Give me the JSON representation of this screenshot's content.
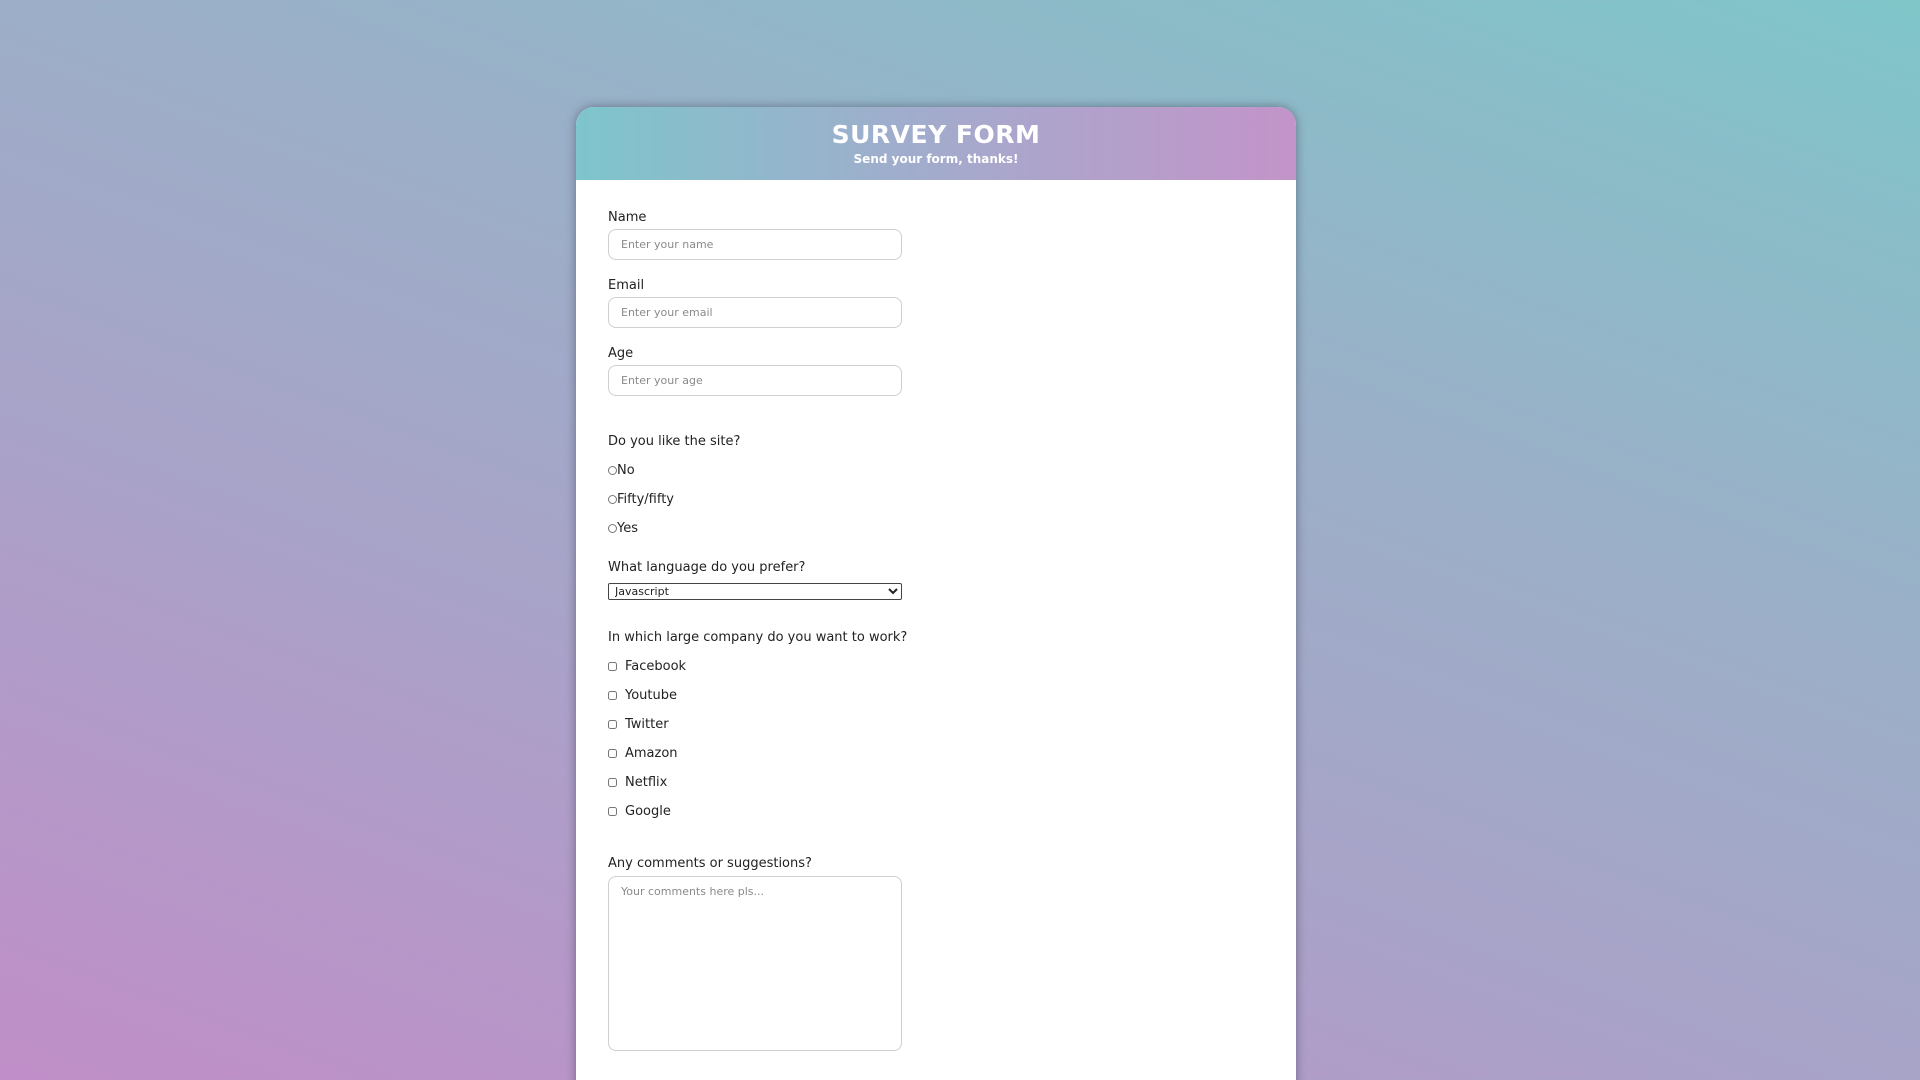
{
  "header": {
    "title": "SURVEY FORM",
    "subtitle": "Send your form, thanks!"
  },
  "fields": {
    "name": {
      "label": "Name",
      "placeholder": "Enter your name",
      "value": ""
    },
    "email": {
      "label": "Email",
      "placeholder": "Enter your email",
      "value": ""
    },
    "age": {
      "label": "Age",
      "placeholder": "Enter your age",
      "value": ""
    }
  },
  "like_site": {
    "question": "Do you like the site?",
    "options": [
      "No",
      "Fifty/fifty",
      "Yes"
    ],
    "selected": null
  },
  "language": {
    "question": "What language do you prefer?",
    "selected": "Javascript"
  },
  "company": {
    "question": "In which large company do you want to work?",
    "options": [
      "Facebook",
      "Youtube",
      "Twitter",
      "Amazon",
      "Netflix",
      "Google"
    ],
    "checked": []
  },
  "comments": {
    "question": "Any comments or suggestions?",
    "placeholder": "Your comments here pls..."
  },
  "colors": {
    "header_gradient_start": "#7ec5cc",
    "header_gradient_end": "#c394c9",
    "background_start": "#c08ec8",
    "background_end": "#7fc6c9"
  }
}
